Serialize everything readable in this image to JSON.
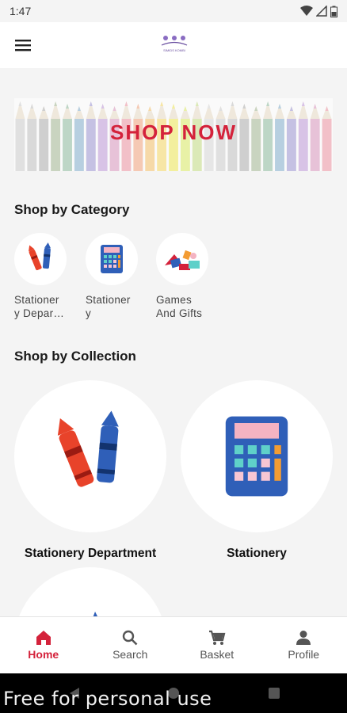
{
  "status_bar": {
    "time": "1:47"
  },
  "header": {
    "logo_text": "SIMIDS KOMBI"
  },
  "banner": {
    "text": "SHOP NOW"
  },
  "categories": {
    "title": "Shop by Category",
    "items": [
      {
        "label": "Stationer\ny Depar…",
        "icon": "crayons-icon"
      },
      {
        "label": "Stationer\ny",
        "icon": "calculator-icon"
      },
      {
        "label": "Games\nAnd Gifts",
        "icon": "toys-icon"
      }
    ]
  },
  "collections": {
    "title": "Shop by Collection",
    "items": [
      {
        "label": "Stationery Department",
        "icon": "crayons-icon"
      },
      {
        "label": "Stationery",
        "icon": "calculator-icon"
      }
    ]
  },
  "bottom_nav": {
    "items": [
      {
        "label": "Home",
        "icon": "home-icon",
        "active": true
      },
      {
        "label": "Search",
        "icon": "search-icon",
        "active": false
      },
      {
        "label": "Basket",
        "icon": "basket-icon",
        "active": false
      },
      {
        "label": "Profile",
        "icon": "profile-icon",
        "active": false
      }
    ]
  },
  "watermark": "Free for personal use",
  "colors": {
    "accent": "#d4223b",
    "background": "#f4f4f4"
  }
}
